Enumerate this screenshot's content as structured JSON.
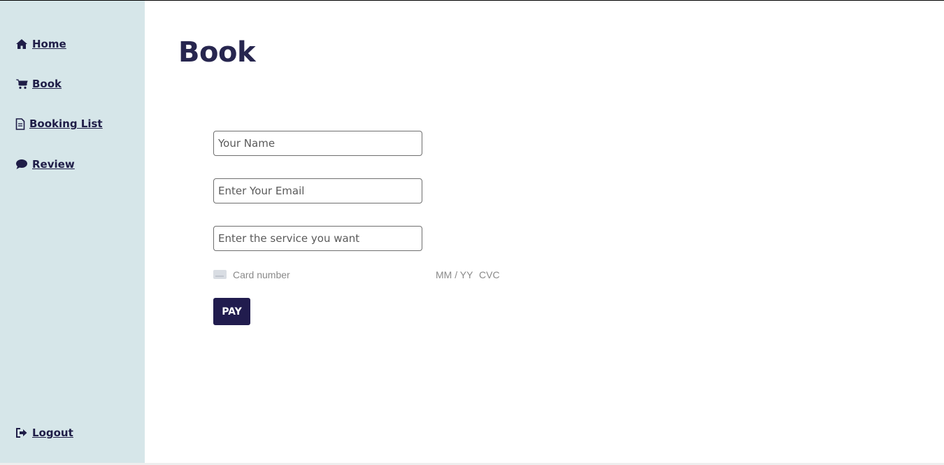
{
  "sidebar": {
    "items": [
      {
        "label": "Home",
        "icon": "home-icon"
      },
      {
        "label": "Book",
        "icon": "cart-icon"
      },
      {
        "label": "Booking List",
        "icon": "document-icon"
      },
      {
        "label": "Review",
        "icon": "comment-icon"
      }
    ],
    "logout": {
      "label": "Logout",
      "icon": "sign-out-icon"
    },
    "background_color": "#d6e6e9"
  },
  "main": {
    "title": "Book",
    "form": {
      "name_placeholder": "Your Name",
      "email_placeholder": "Enter Your Email",
      "service_placeholder": "Enter the service you want",
      "card": {
        "number_placeholder": "Card number",
        "expiry_placeholder": "MM / YY",
        "cvc_placeholder": "CVC"
      },
      "pay_label": "PAY"
    }
  },
  "colors": {
    "accent": "#211c4e",
    "title": "#27264f"
  }
}
